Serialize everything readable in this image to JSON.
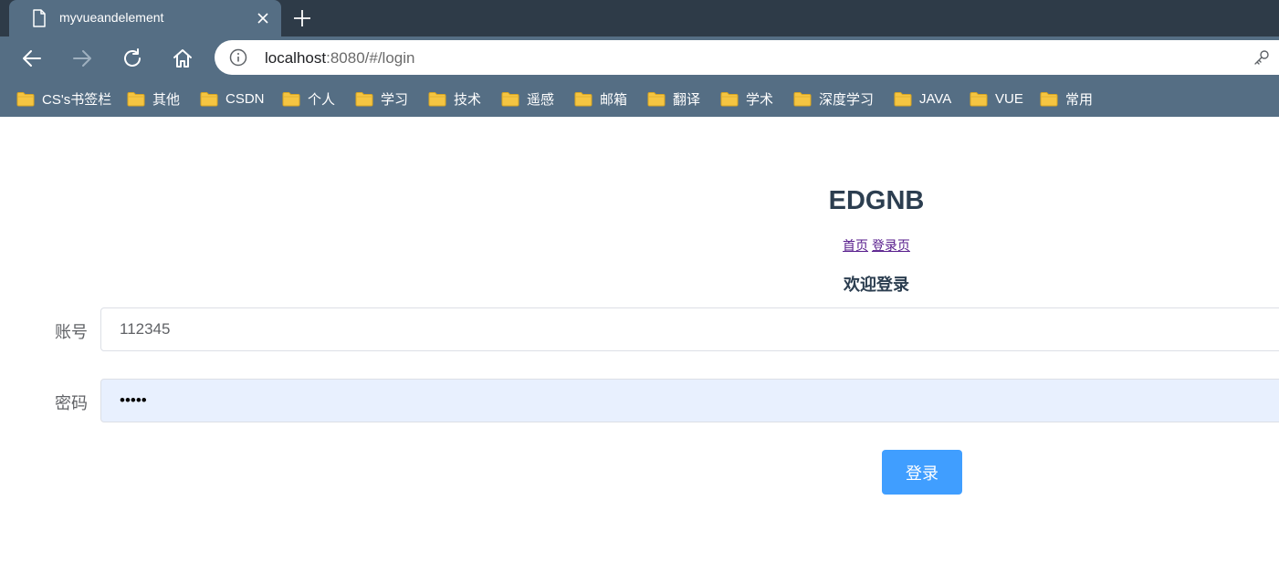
{
  "browser": {
    "tab_title": "myvueandelement",
    "url_host": "localhost",
    "url_rest": ":8080/#/login"
  },
  "bookmarks": [
    {
      "label": "CS's书签栏",
      "icon": "folder-icon"
    },
    {
      "label": "其他",
      "icon": "folder-icon"
    },
    {
      "label": "CSDN",
      "icon": "folder-icon"
    },
    {
      "label": "个人",
      "icon": "folder-icon"
    },
    {
      "label": "学习",
      "icon": "folder-icon"
    },
    {
      "label": "技术",
      "icon": "folder-icon"
    },
    {
      "label": "遥感",
      "icon": "folder-icon"
    },
    {
      "label": "邮箱",
      "icon": "folder-icon"
    },
    {
      "label": "翻译",
      "icon": "folder-icon"
    },
    {
      "label": "学术",
      "icon": "folder-icon"
    },
    {
      "label": "深度学习",
      "icon": "folder-icon"
    },
    {
      "label": "JAVA",
      "icon": "folder-icon"
    },
    {
      "label": "VUE",
      "icon": "folder-icon"
    },
    {
      "label": "常用",
      "icon": "folder-icon"
    }
  ],
  "page": {
    "title": "EDGNB",
    "nav_home": "首页",
    "nav_login": "登录页",
    "welcome": "欢迎登录",
    "account_label": "账号",
    "account_value": "112345",
    "password_label": "密码",
    "password_value": "•••••",
    "login_button": "登录"
  },
  "colors": {
    "tabstrip": "#2e3b48",
    "toolbar": "#556e84",
    "primary_button": "#409eff",
    "heading": "#2c3e50",
    "autofill_bg": "#e8f0fe",
    "folder": "#f5c542"
  }
}
